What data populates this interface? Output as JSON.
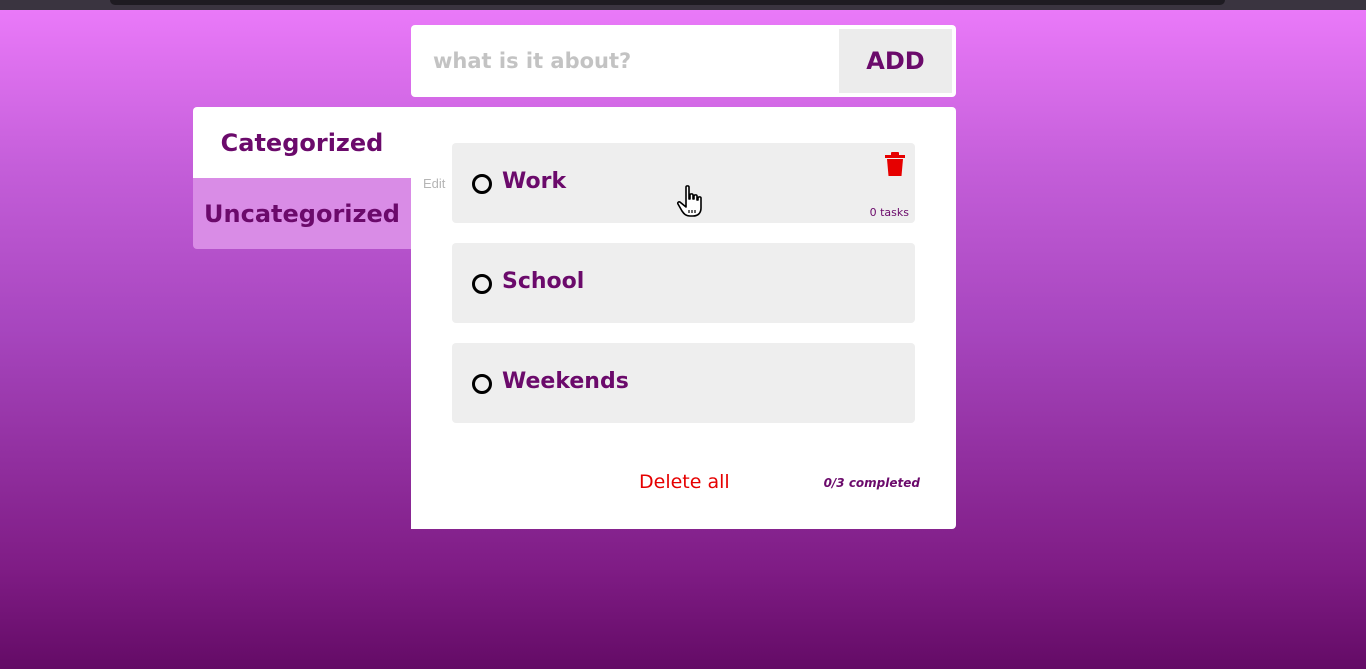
{
  "add_form": {
    "placeholder": "what is it about?",
    "button_label": "ADD"
  },
  "tabs": [
    {
      "label": "Categorized",
      "active": true
    },
    {
      "label": "Uncategorized",
      "active": false
    }
  ],
  "edit_label": "Edit",
  "categories": [
    {
      "title": "Work",
      "task_count": "0 tasks",
      "hovered": true
    },
    {
      "title": "School"
    },
    {
      "title": "Weekends"
    }
  ],
  "footer": {
    "delete_all_label": "Delete all",
    "completed_label": "0/3 completed"
  },
  "colors": {
    "accent": "#6b0a6b",
    "danger": "#e60000",
    "card_bg": "#eeeeee",
    "inactive_tab_bg": "#d98ce6"
  },
  "icons": {
    "trash": "trash-icon",
    "radio": "circle-outline-icon",
    "cursor": "hand-pointer-cursor"
  }
}
